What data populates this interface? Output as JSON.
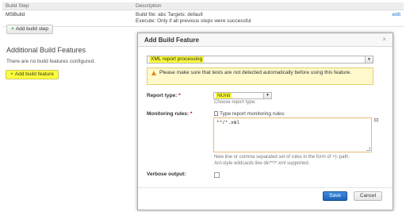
{
  "build_steps": {
    "headers": [
      "Build Step",
      "Description"
    ],
    "rows": [
      {
        "name": "MSBuild",
        "description_line1": "Build file: abc Targets: default",
        "description_line2": "Execute: Only if all previous steps were successful",
        "action": "edit"
      }
    ],
    "add_step_label": "Add build step"
  },
  "features": {
    "title": "Additional Build Features",
    "empty_text": "There are no build features configured.",
    "add_feature_label": "Add build feature"
  },
  "dialog": {
    "title": "Add Build Feature",
    "close_glyph": "×",
    "feature_selected": "XML report processing",
    "warning": "Please make sure that tests are not detected automatically before using this feature.",
    "report_type_label": "Report type:",
    "report_type_value": "NUnit",
    "report_type_note": "Choose report type.",
    "monitoring_rules_label": "Monitoring rules:",
    "monitoring_rules_hint": "Type report monitoring rules:",
    "monitoring_rules_value": "**/*.xml",
    "rules_note_line1": "New line or comma separated set of rules in the form of +|-:path.",
    "rules_note_line2": "Ant-style wildcards like dir/**/*.xml supported.",
    "verbose_label": "Verbose output:",
    "verbose_checked": false,
    "required_mark": "*",
    "save_label": "Save",
    "cancel_label": "Cancel"
  },
  "colors": {
    "highlight": "#ffff3c",
    "primary_button": "#2a74c9",
    "warning_bg": "#fff9cc"
  }
}
